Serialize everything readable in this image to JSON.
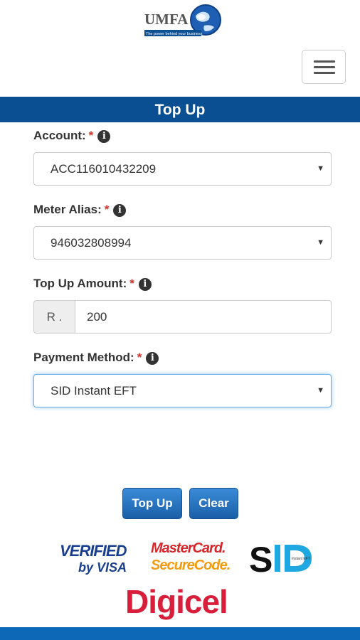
{
  "header": {
    "logo_text": "UMFA",
    "logo_tagline": "The power behind your business",
    "menu_icon": "hamburger-menu-icon"
  },
  "page": {
    "title": "Top Up"
  },
  "form": {
    "account": {
      "label": "Account:",
      "required_mark": "*",
      "info_icon": "info-icon",
      "value": "ACC116010432209"
    },
    "meter_alias": {
      "label": "Meter Alias:",
      "required_mark": "*",
      "info_icon": "info-icon",
      "value": "946032808994"
    },
    "amount": {
      "label": "Top Up Amount:",
      "required_mark": "*",
      "info_icon": "info-icon",
      "currency": "R .",
      "value": "200"
    },
    "payment_method": {
      "label": "Payment Method:",
      "required_mark": "*",
      "info_icon": "info-icon",
      "value": "SID Instant EFT"
    }
  },
  "actions": {
    "topup_label": "Top Up",
    "clear_label": "Clear"
  },
  "logos": {
    "verified_top": "VERIFIED",
    "verified_bottom": "by VISA",
    "mastercard_top": "MasterCard.",
    "mastercard_bottom": "SecureCode.",
    "sid_text": "SID",
    "sid_small": "Instant EFT",
    "digicel": "Digicel"
  },
  "colors": {
    "brand_blue": "#0b4f93",
    "required_red": "#d9342b",
    "button_blue": "#1a5fa8"
  }
}
